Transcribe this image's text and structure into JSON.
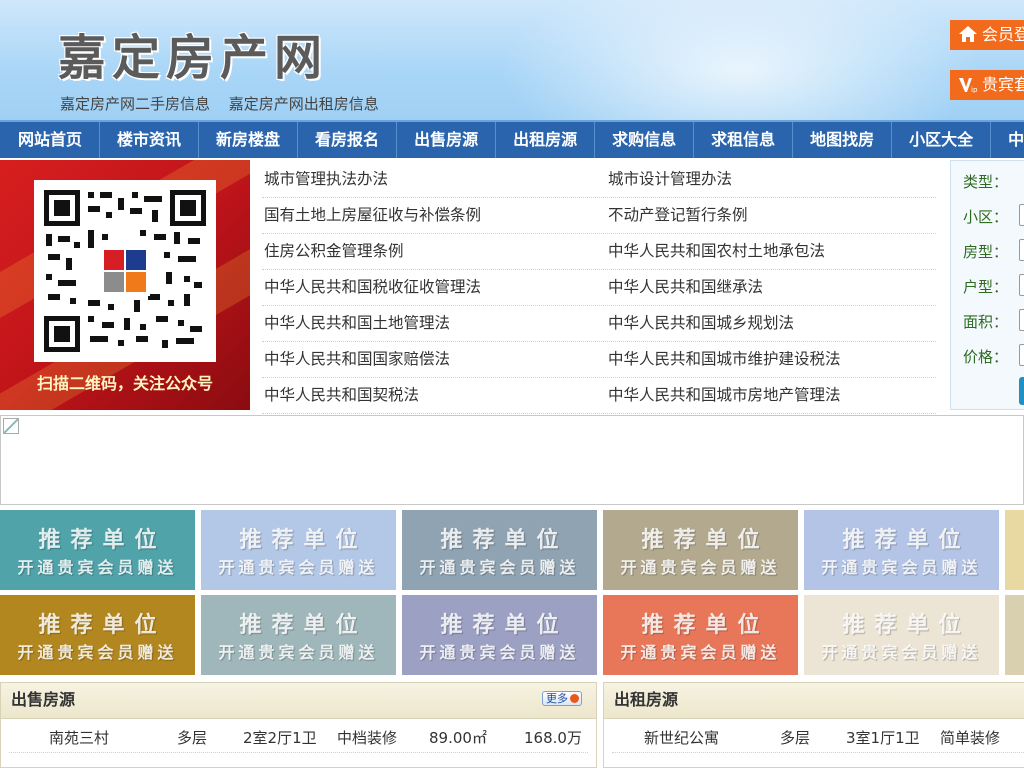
{
  "header": {
    "logo": "嘉定房产网",
    "sublinks": [
      "嘉定房产网二手房信息",
      "嘉定房产网出租房信息"
    ],
    "login_button": "会员登",
    "vip_button": "贵宾套"
  },
  "nav": [
    "网站首页",
    "楼市资讯",
    "新房楼盘",
    "看房报名",
    "出售房源",
    "出租房源",
    "求购信息",
    "求租信息",
    "地图找房",
    "小区大全",
    "中"
  ],
  "qr": {
    "caption": "扫描二维码，关注公众号"
  },
  "laws": [
    [
      "城市管理执法办法",
      "城市设计管理办法"
    ],
    [
      "国有土地上房屋征收与补偿条例",
      "不动产登记暂行条例"
    ],
    [
      "住房公积金管理条例",
      "中华人民共和国农村土地承包法"
    ],
    [
      "中华人民共和国税收征收管理法",
      "中华人民共和国继承法"
    ],
    [
      "中华人民共和国土地管理法",
      "中华人民共和国城乡规划法"
    ],
    [
      "中华人民共和国国家赔偿法",
      "中华人民共和国城市维护建设税法"
    ],
    [
      "中华人民共和国契税法",
      "中华人民共和国城市房地产管理法"
    ]
  ],
  "search": {
    "labels": [
      "类型：",
      "小区：",
      "房型：",
      "户型：",
      "面积：",
      "价格："
    ]
  },
  "tiles": {
    "title": "推荐单位",
    "subtitle": "开通贵宾会员赠送",
    "colors": [
      "#4fa3a9",
      "#b3c7e6",
      "#8fa3b3",
      "#b3a98f",
      "#b3c4e6",
      "#e8d9a3",
      "#b3871f",
      "#9fb7bb",
      "#9ca1c4",
      "#e8775a",
      "#ece4d4",
      "#d9d0b0"
    ]
  },
  "sale_panel": {
    "title": "出售房源",
    "more": "更多",
    "rows": [
      [
        "南苑三村",
        "多层",
        "2室2厅1卫",
        "中档装修",
        "89.00㎡",
        "168.0万"
      ]
    ]
  },
  "rent_panel": {
    "title": "出租房源",
    "rows": [
      [
        "新世纪公寓",
        "多层",
        "3室1厅1卫",
        "简单装修"
      ]
    ]
  }
}
